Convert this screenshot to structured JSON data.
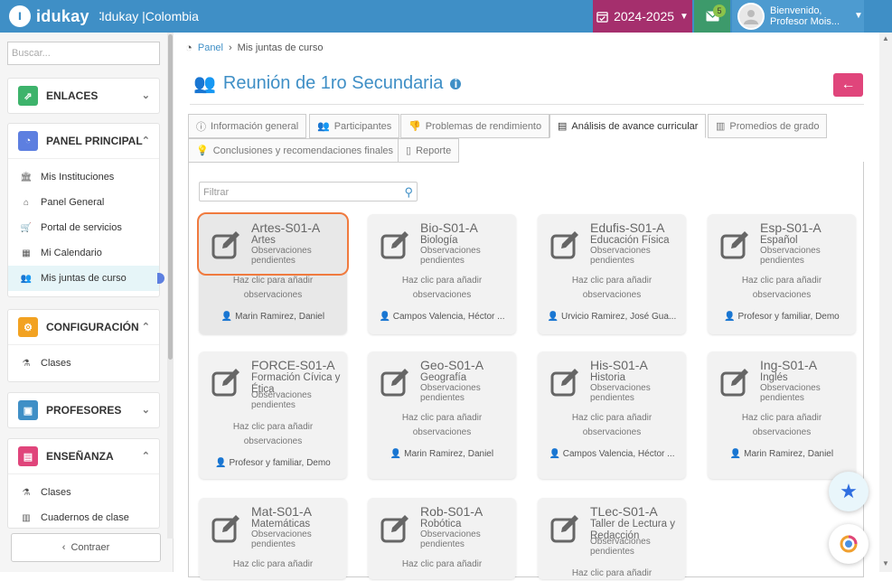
{
  "header": {
    "brand": "idukay",
    "brand_sep": ":",
    "institution": "Idukay |Colombia",
    "year": "2024-2025",
    "messages_count": "5",
    "user_greeting": "Bienvenido,",
    "user_name": "Profesor Mois..."
  },
  "sidebar": {
    "search_placeholder": "Buscar...",
    "sections": [
      {
        "label": "ENLACES",
        "color": "#3db36b",
        "icon": "external-link-icon",
        "items": []
      },
      {
        "label": "PANEL PRINCIPAL",
        "color": "#5d7fe0",
        "icon": "dashboard-icon",
        "items": [
          {
            "label": "Mis Instituciones",
            "icon": "institution-icon"
          },
          {
            "label": "Panel General",
            "icon": "home-icon"
          },
          {
            "label": "Portal de servicios",
            "icon": "cart-icon"
          },
          {
            "label": "Mi Calendario",
            "icon": "calendar-icon"
          },
          {
            "label": "Mis juntas de curso",
            "icon": "users-icon"
          }
        ]
      },
      {
        "label": "CONFIGURACIÓN",
        "color": "#f2a222",
        "icon": "cogs-icon",
        "items": [
          {
            "label": "Clases",
            "icon": "flask-icon"
          }
        ]
      },
      {
        "label": "PROFESORES",
        "color": "#3f8fc6",
        "icon": "id-card-icon",
        "items": []
      },
      {
        "label": "ENSEÑANZA",
        "color": "#e0457b",
        "icon": "book-icon",
        "items": [
          {
            "label": "Clases",
            "icon": "flask-icon"
          },
          {
            "label": "Cuadernos de clase",
            "icon": "notebook-icon"
          }
        ]
      }
    ],
    "collapse_label": "Contraer"
  },
  "breadcrumb": {
    "panel": "Panel",
    "current": "Mis juntas de curso"
  },
  "page": {
    "title": "Reunión de 1ro Secundaria"
  },
  "tabs": [
    "Información general",
    "Participantes",
    "Problemas de rendimiento",
    "Análisis de avance curricular",
    "Promedios de grado",
    "Conclusiones y recomendaciones finales",
    "Reporte"
  ],
  "filter": {
    "placeholder": "Filtrar"
  },
  "cards": [
    {
      "code": "Artes-S01-A",
      "name": "Artes",
      "status": "Observaciones pendientes",
      "hint": "Haz clic para añadir observaciones",
      "teacher": "Marin Ramirez, Daniel"
    },
    {
      "code": "Bio-S01-A",
      "name": "Biología",
      "status": "Observaciones pendientes",
      "hint": "Haz clic para añadir observaciones",
      "teacher": "Campos Valencia, Héctor ..."
    },
    {
      "code": "Edufis-S01-A",
      "name": "Educación Física",
      "status": "Observaciones pendientes",
      "hint": "Haz clic para añadir observaciones",
      "teacher": "Urvicio Ramirez, José Gua..."
    },
    {
      "code": "Esp-S01-A",
      "name": "Español",
      "status": "Observaciones pendientes",
      "hint": "Haz clic para añadir observaciones",
      "teacher": "Profesor y familiar, Demo"
    },
    {
      "code": "FORCE-S01-A",
      "name": "Formación Cívica y Ética",
      "status": "Observaciones pendientes",
      "hint": "Haz clic para añadir observaciones",
      "teacher": "Profesor y familiar, Demo"
    },
    {
      "code": "Geo-S01-A",
      "name": "Geografía",
      "status": "Observaciones pendientes",
      "hint": "Haz clic para añadir observaciones",
      "teacher": "Marin Ramirez, Daniel"
    },
    {
      "code": "His-S01-A",
      "name": "Historia",
      "status": "Observaciones pendientes",
      "hint": "Haz clic para añadir observaciones",
      "teacher": "Campos Valencia, Héctor ..."
    },
    {
      "code": "Ing-S01-A",
      "name": "Inglés",
      "status": "Observaciones pendientes",
      "hint": "Haz clic para añadir observaciones",
      "teacher": "Marin Ramirez, Daniel"
    },
    {
      "code": "Mat-S01-A",
      "name": "Matemáticas",
      "status": "Observaciones pendientes",
      "hint": "Haz clic para añadir",
      "teacher": ""
    },
    {
      "code": "Rob-S01-A",
      "name": "Robótica",
      "status": "Observaciones pendientes",
      "hint": "Haz clic para añadir",
      "teacher": ""
    },
    {
      "code": "TLec-S01-A",
      "name": "Taller de Lectura y Redacción",
      "status": "Observaciones pendientes",
      "hint": "Haz clic para añadir",
      "teacher": ""
    }
  ],
  "colors": {
    "primary": "#3f8fc6",
    "year_bg": "#a52f6d",
    "messages_bg": "#3d9a6b",
    "back_button": "#e0457b",
    "highlight_outline": "#f07a3e"
  }
}
